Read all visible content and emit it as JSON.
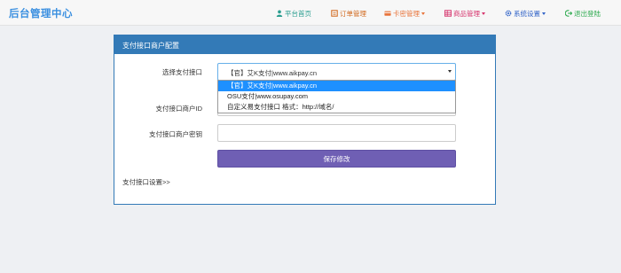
{
  "brand": "后台管理中心",
  "nav": [
    {
      "label": "平台首页",
      "icon": "user-icon",
      "color": "#2a9d8f",
      "caret": false
    },
    {
      "label": "订单管理",
      "icon": "list-icon",
      "color": "#d2691e",
      "caret": false
    },
    {
      "label": "卡密管理",
      "icon": "card-icon",
      "color": "#e8743b",
      "caret": true
    },
    {
      "label": "商品管理",
      "icon": "grid-icon",
      "color": "#d6336c",
      "caret": true
    },
    {
      "label": "系统设置",
      "icon": "gear-icon",
      "color": "#3264c8",
      "caret": true
    },
    {
      "label": "退出登陆",
      "icon": "logout-icon",
      "color": "#2eaa4f",
      "caret": false
    }
  ],
  "panel": {
    "title": "支付接口商户配置",
    "select_label": "选择支付接口",
    "selected_value": "【官】艾K支付|www.aikpay.cn",
    "options": [
      "【官】艾K支付|www.aikpay.cn",
      "OSU支付|www.osupay.com",
      "自定义易支付接口 格式：http://域名/"
    ],
    "merchant_id_label": "支付接口商户ID",
    "merchant_id_value": "",
    "merchant_key_label": "支付接口商户密钥",
    "merchant_key_value": "",
    "save_label": "保存修改",
    "link_label": "支付接口设置>>"
  }
}
